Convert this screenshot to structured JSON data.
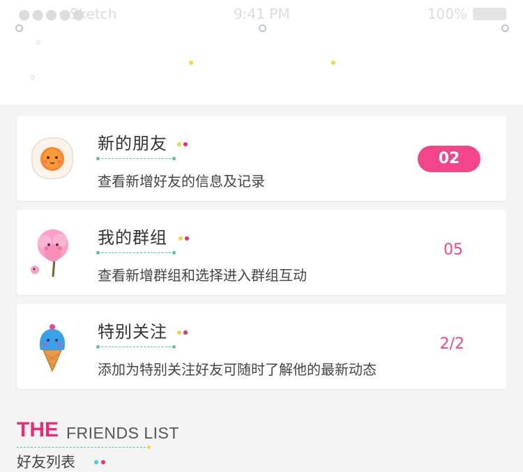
{
  "status_bar": {
    "signal": "●●●●●",
    "carrier": "Sketch",
    "time": "9:41 PM",
    "battery_percent": "100%"
  },
  "cards": [
    {
      "title": "新的朋友",
      "description": "查看新增好友的信息及记录",
      "count": "02",
      "count_style": "pill",
      "icon": "fried-egg-icon"
    },
    {
      "title": "我的群组",
      "description": "查看新增群组和选择进入群组互动",
      "count": "05",
      "count_style": "text",
      "icon": "cotton-candy-icon"
    },
    {
      "title": "特别关注",
      "description": "添加为特别关注好友可随时了解他的最新动态",
      "count": "2/2",
      "count_style": "text",
      "icon": "ice-cream-icon"
    }
  ],
  "friends_section": {
    "title_bold": "THE",
    "title_rest": "FRIENDS LIST",
    "subtitle": "好友列表"
  },
  "colors": {
    "accent_pink": "#f2458a",
    "dot_yellow": "#f4d83a",
    "dot_magenta": "#ee2a78",
    "underline_green": "#4fc69c",
    "dot_cyan": "#4cc8e0"
  }
}
